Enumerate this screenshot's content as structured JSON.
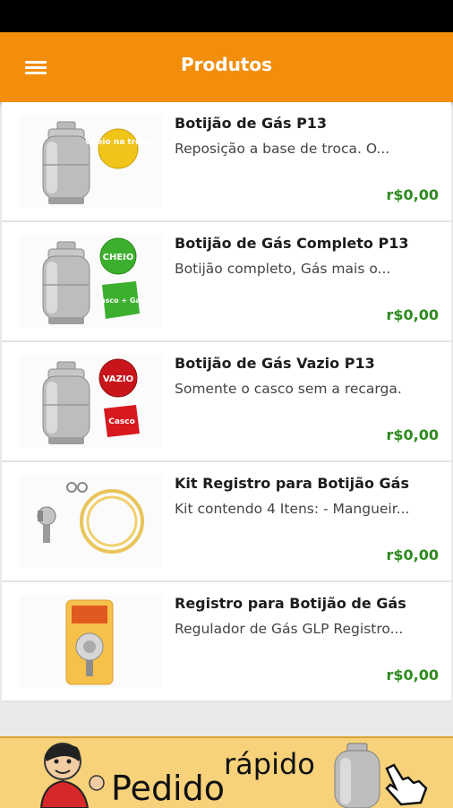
{
  "app_bar": {
    "title": "Produtos",
    "menu_icon": "hamburger-menu-icon"
  },
  "products": [
    {
      "name": "Botijão de Gás P13",
      "description": "Reposição a base de troca. O...",
      "price": "r$0,00",
      "badge": "Cheio na troca",
      "badge_color": "#f0c419"
    },
    {
      "name": "Botijão de Gás Completo P13",
      "description": "Botijão completo, Gás mais o...",
      "price": "r$0,00",
      "badge": "CHEIO",
      "badge2": "Casco + Gás",
      "badge_color": "#3cb02e"
    },
    {
      "name": "Botijão de Gás Vazio P13",
      "description": "Somente o casco sem a recarga.",
      "price": "r$0,00",
      "badge": "VAZIO",
      "badge2": "Casco",
      "badge_color": "#c8151b"
    },
    {
      "name": "Kit Registro para Botijão Gás",
      "description": "Kit contendo 4 Itens: - Mangueir...",
      "price": "r$0,00"
    },
    {
      "name": "Registro para Botijão de Gás",
      "description": "Regulador de Gás GLP Registro...",
      "price": "r$0,00"
    }
  ],
  "banner": {
    "main": "Pedido",
    "sub": "rápido"
  },
  "colors": {
    "accent": "#f28e0c",
    "price": "#2e8b1f"
  }
}
